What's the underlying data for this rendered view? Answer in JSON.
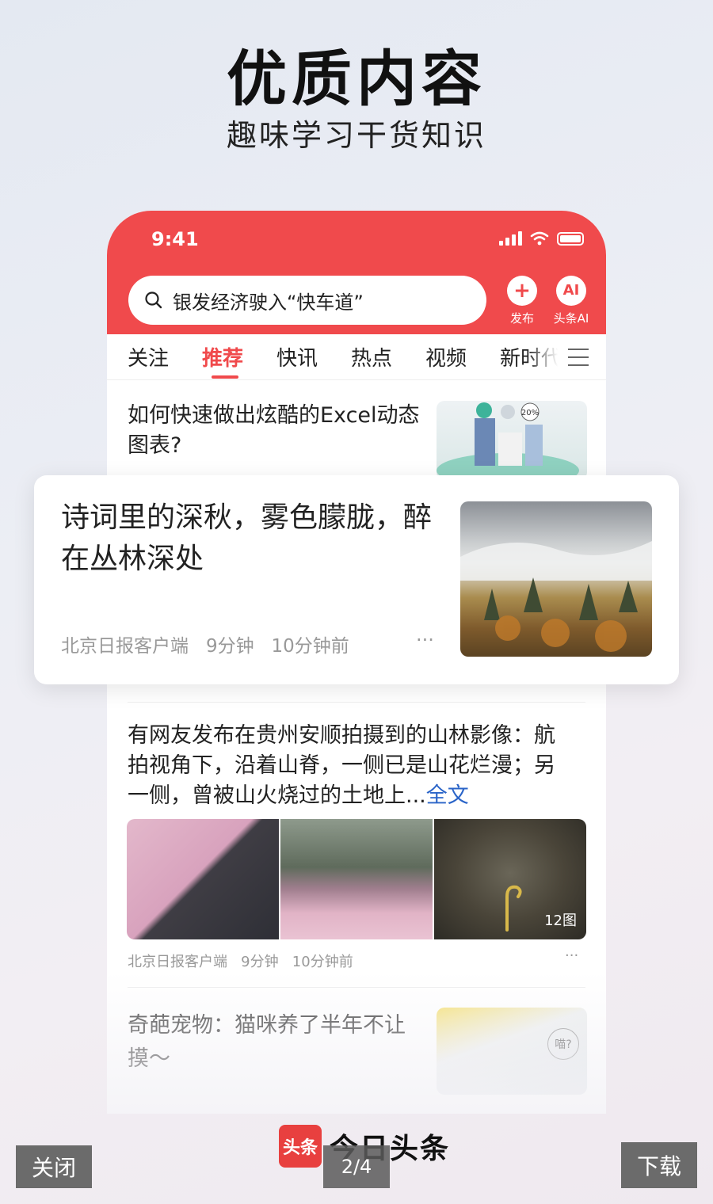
{
  "promo": {
    "headline": "优质内容",
    "subheadline": "趣味学习干货知识"
  },
  "phone": {
    "status_time": "9:41",
    "search_placeholder": "银发经济驶入“快车道”",
    "publish_label": "发布",
    "publish_icon": "+",
    "ai_label": "头条AI",
    "ai_icon": "AI",
    "tabs": [
      "关注",
      "推荐",
      "快讯",
      "热点",
      "视频",
      "新时代"
    ],
    "active_tab": "推荐",
    "colors": {
      "brand_red": "#f04a4c",
      "link_blue": "#2a64c8"
    }
  },
  "articles": [
    {
      "title": "如何快速做出炫酷的Excel动态图表?",
      "image_badge": "20%"
    },
    {
      "title": "诗词里的深秋，雾色朦胧，醉在丛林深处",
      "source": "北京日报客户端",
      "read_time": "9分钟",
      "posted": "10分钟前",
      "more": "···"
    },
    {
      "title": "有网友发布在贵州安顺拍摄到的山林影像：航拍视角下，沿着山脊，一侧已是山花烂漫；另一侧，曾被山火烧过的土地上...",
      "full_text_link": "全文",
      "image_count": "12图",
      "source": "北京日报客户端",
      "read_time": "9分钟",
      "posted": "10分钟前",
      "more": "···"
    },
    {
      "title": "奇葩宠物：猫咪养了半年不让摸～",
      "image_badge": "喵?"
    }
  ],
  "brand": {
    "logo_text": "头条",
    "name": "今日头条"
  },
  "controls": {
    "close": "关闭",
    "page_indicator": "2/4",
    "download": "下载"
  }
}
